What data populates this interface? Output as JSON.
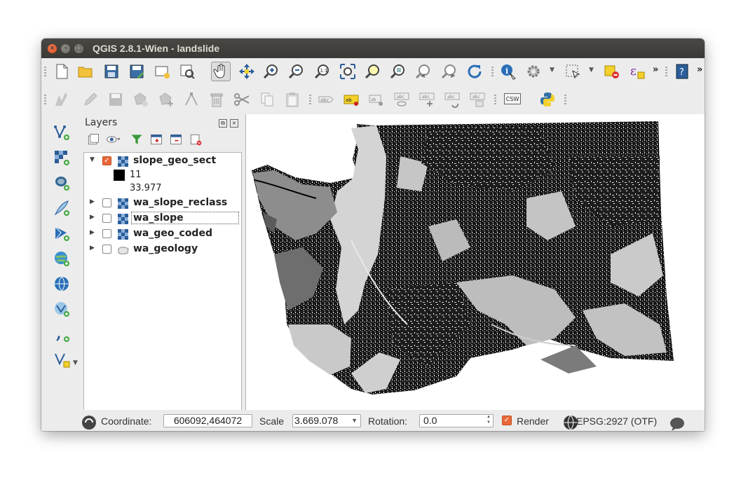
{
  "window": {
    "title": "QGIS 2.8.1-Wien - landslide"
  },
  "toolbar1": {
    "icons": [
      "new-project",
      "open-project",
      "save-project",
      "save-as",
      "new-print-composer",
      "composer-manager",
      "pan-map",
      "pan-to-selection",
      "zoom-in",
      "zoom-out",
      "zoom-native",
      "zoom-full",
      "zoom-to-selection",
      "zoom-to-layer",
      "zoom-last",
      "zoom-next",
      "refresh",
      "identify",
      "action",
      "select-features",
      "deselect",
      "expression",
      "help"
    ],
    "more_label": "»"
  },
  "toolbar2": {
    "icons": [
      "digitize",
      "toggle-edit",
      "save-edits",
      "add-feature",
      "move-feature",
      "node-tool",
      "delete-selected",
      "cut",
      "copy",
      "paste",
      "label",
      "layer-labeling",
      "pin-labels",
      "show-hide-labels",
      "move-label",
      "rotate-label",
      "change-label"
    ],
    "csw_label": "CSW"
  },
  "layers_panel": {
    "title": "Layers",
    "items": [
      {
        "name": "slope_geo_sect",
        "checked": true,
        "expanded": true,
        "type": "raster"
      },
      {
        "name": "wa_slope_reclass",
        "checked": false,
        "expanded": false,
        "type": "raster"
      },
      {
        "name": "wa_slope",
        "checked": false,
        "expanded": false,
        "type": "raster"
      },
      {
        "name": "wa_geo_coded",
        "checked": false,
        "expanded": false,
        "type": "raster"
      },
      {
        "name": "wa_geology",
        "checked": false,
        "expanded": false,
        "type": "vector"
      }
    ],
    "legend": {
      "value1": "11",
      "value2": "33.977"
    }
  },
  "status_bar": {
    "coordinate_label": "Coordinate:",
    "coordinate_value": "606092,464072",
    "scale_label": "Scale",
    "scale_value": "3.669.078",
    "rotation_label": "Rotation:",
    "rotation_value": "0.0",
    "render_label": "Render",
    "render_checked": true,
    "crs_label": "EPSG:2927 (OTF)"
  },
  "colors": {
    "accent": "#e9683a",
    "titlebar": "#3c3b37",
    "map_dark": "#151515",
    "map_mid": "#777777",
    "map_light": "#c8c8c8"
  }
}
